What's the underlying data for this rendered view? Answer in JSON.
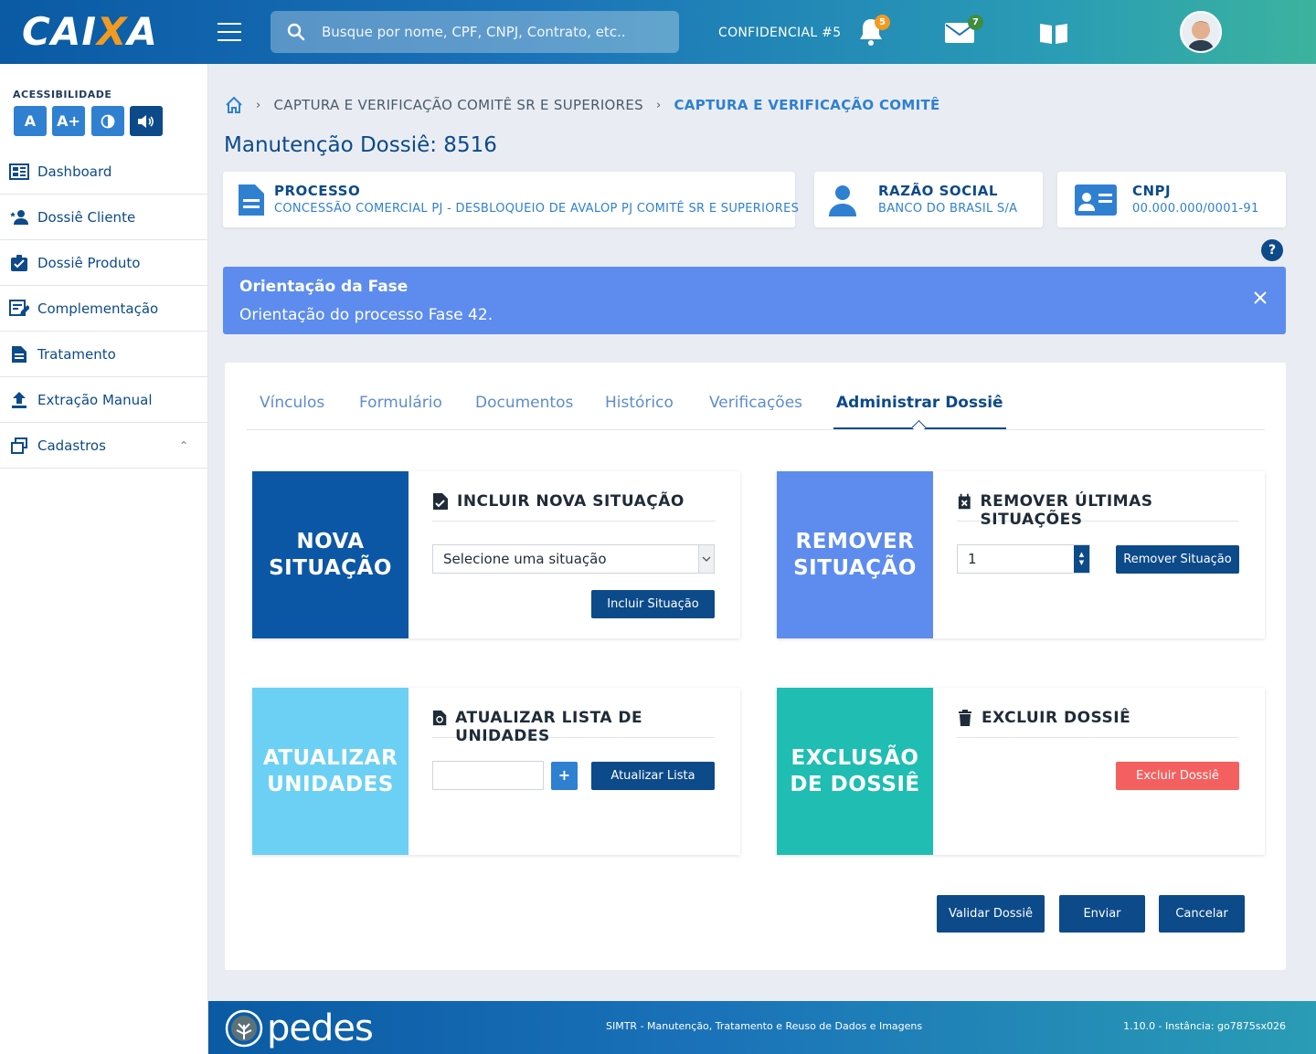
{
  "header": {
    "logo_text_a": "CAI",
    "logo_text_x": "X",
    "logo_text_b": "A",
    "search_placeholder": "Busque por nome, CPF, CNPJ, Contrato, etc..",
    "confidential": "CONFIDENCIAL #5",
    "notifications_count": "5",
    "messages_count": "7"
  },
  "sidebar": {
    "accessibility_label": "ACESSIBILIDADE",
    "acc_buttons": [
      "A",
      "A+"
    ],
    "items": [
      {
        "label": "Dashboard",
        "icon": "dashboard-icon"
      },
      {
        "label": "Dossiê Cliente",
        "icon": "client-icon"
      },
      {
        "label": "Dossiê Produto",
        "icon": "product-icon"
      },
      {
        "label": "Complementação",
        "icon": "complement-icon"
      },
      {
        "label": "Tratamento",
        "icon": "document-icon"
      },
      {
        "label": "Extração Manual",
        "icon": "upload-icon"
      },
      {
        "label": "Cadastros",
        "icon": "windows-icon"
      }
    ]
  },
  "breadcrumb": {
    "parent": "CAPTURA E VERIFICAÇÃO COMITÊ SR E SUPERIORES",
    "current": "CAPTURA E VERIFICAÇÃO COMITÊ"
  },
  "page_title": "Manutenção Dossiê: 8516",
  "info": {
    "process_label": "PROCESSO",
    "process_value": "CONCESSÃO COMERCIAL PJ - DESBLOQUEIO DE AVALOP PJ COMITÊ SR E SUPERIORES",
    "company_label": "RAZÃO SOCIAL",
    "company_value": "BANCO DO BRASIL S/A",
    "cnpj_label": "CNPJ",
    "cnpj_value": "00.000.000/0001-91"
  },
  "help": "?",
  "alert": {
    "title": "Orientação da Fase",
    "body": "Orientação do processo Fase 42."
  },
  "tabs": [
    "Vínculos",
    "Formulário",
    "Documentos",
    "Histórico",
    "Verificações",
    "Administrar Dossiê"
  ],
  "cards": {
    "nova": {
      "side_line1": "NOVA",
      "side_line2": "SITUAÇÃO",
      "title": "INCLUIR NOVA SITUAÇÃO",
      "select_value": "Selecione uma situação",
      "button": "Incluir Situação",
      "color": "#0c56a6"
    },
    "remover": {
      "side_line1": "REMOVER",
      "side_line2": "SITUAÇÃO",
      "title": "REMOVER ÚLTIMAS SITUAÇÕES",
      "input_value": "1",
      "button": "Remover Situação",
      "color": "#5d8cee"
    },
    "atualizar": {
      "side_line1": "ATUALIZAR",
      "side_line2": "UNIDADES",
      "title": "ATUALIZAR LISTA DE UNIDADES",
      "plus": "+",
      "button": "Atualizar Lista",
      "color": "#6cd0f5"
    },
    "excluir": {
      "side_line1": "EXCLUSÃO",
      "side_line2": "DE DOSSIÊ",
      "title": "EXCLUIR DOSSIÊ",
      "button": "Excluir Dossiê",
      "color": "#1fbdb2",
      "button_color": "#f4605f"
    }
  },
  "actions": {
    "validar": "Validar Dossiê",
    "enviar": "Enviar",
    "cancelar": "Cancelar"
  },
  "footer": {
    "brand": "pedes",
    "system": "SIMTR - Manutenção, Tratamento e Reuso de Dados e Imagens",
    "version": "1.10.0 - Instância: go7875sx026"
  }
}
